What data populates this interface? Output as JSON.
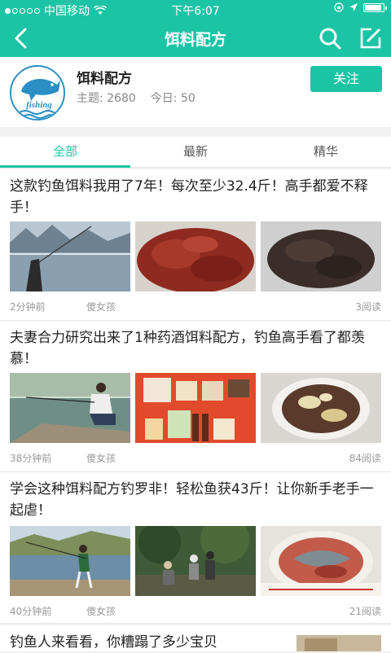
{
  "status_bar": {
    "carrier": "中国移动",
    "time": "下午6:07",
    "signal_dots_filled": 1,
    "signal_dots_total": 5,
    "battery_level": 0.9
  },
  "navbar": {
    "title": "饵料配方",
    "back_icon": "back-chevron-icon",
    "search_icon": "search-icon",
    "edit_icon": "compose-icon"
  },
  "forum": {
    "name": "饵料配方",
    "topics": "主题: 2680",
    "today": "今日: 50",
    "follow_label": "关注",
    "logo_text": "fishing"
  },
  "tabs": [
    {
      "label": "全部",
      "active": true
    },
    {
      "label": "最新",
      "active": false
    },
    {
      "label": "精华",
      "active": false
    }
  ],
  "posts": [
    {
      "title": "这款钓鱼饵料我用了7年！每次至少32.4斤！高手都爱不释手！",
      "time": "2分钟前",
      "author": "傻女孩",
      "reads": "3阅读"
    },
    {
      "title": "夫妻合力研究出来了1种药酒饵料配方，钓鱼高手看了都羡慕！",
      "time": "38分钟前",
      "author": "傻女孩",
      "reads": "84阅读"
    },
    {
      "title": "学会这种饵料配方钓罗非！轻松鱼获43斤！让你新手老手一起虐！",
      "time": "40分钟前",
      "author": "傻女孩",
      "reads": "21阅读"
    },
    {
      "title": "钓鱼人来看看，你糟蹋了多少宝贝",
      "time": "",
      "author": "",
      "reads": ""
    }
  ],
  "colors": {
    "accent": "#1cc4a6",
    "text": "#222222",
    "muted": "#999999"
  }
}
